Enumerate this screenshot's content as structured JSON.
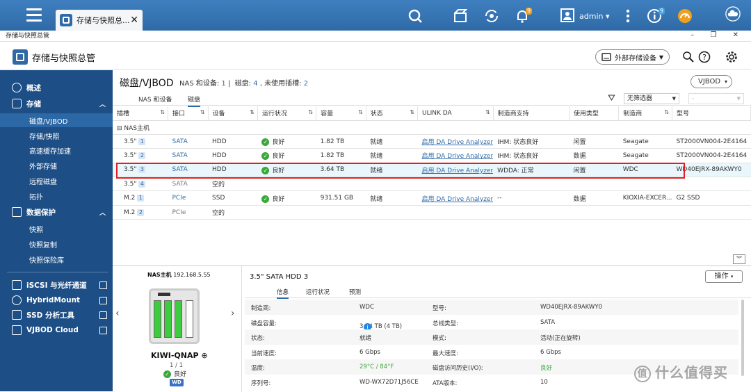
{
  "topbar": {
    "tab_title": "存储与快照总...",
    "tab_close": "✕",
    "notif_badge": "9",
    "info_badge": "9",
    "user": "admin ▾"
  },
  "window_title": "存储与快照总管",
  "window_controls": "– ❐ ✕",
  "app": {
    "title": "存储与快照总管",
    "external_button": "外部存储设备"
  },
  "sidebar": {
    "items": [
      {
        "label": "概述",
        "icon": "dashboard-icon"
      },
      {
        "label": "存储",
        "icon": "storage-icon"
      },
      {
        "label": "磁盘/VJBOD"
      },
      {
        "label": "存储/快照"
      },
      {
        "label": "高速缓存加速"
      },
      {
        "label": "外部存储"
      },
      {
        "label": "远程磁盘"
      },
      {
        "label": "拓扑"
      },
      {
        "label": "数据保护",
        "icon": "shield-icon"
      },
      {
        "label": "快照"
      },
      {
        "label": "快照复制"
      },
      {
        "label": "快照保险库"
      },
      {
        "label": "iSCSI 与光纤通道"
      },
      {
        "label": "HybridMount"
      },
      {
        "label": "SSD 分析工具"
      },
      {
        "label": "VJBOD Cloud"
      }
    ]
  },
  "main": {
    "heading": "磁盘/VJBOD",
    "sub_prefix1": "NAS 和设备:",
    "nas_count": "1",
    "sub_prefix2": "磁盘:",
    "disk_count": "4",
    "sub_prefix3": ", 未使用插槽:",
    "unused_slots": "2",
    "vjbod_btn": "VJBOD",
    "tabs": [
      "NAS 和设备",
      "磁盘"
    ],
    "filter_value": "无筛选器",
    "filter2_value": "-",
    "columns": [
      "插槽",
      "接口",
      "设备",
      "运行状况",
      "容量",
      "状态",
      "ULINK DA",
      "制造商支持",
      "使用类型",
      "制造商",
      "型号"
    ],
    "group_label": "NAS主机",
    "rows": [
      {
        "slot": "3.5\"",
        "num": "1",
        "iface": "SATA",
        "dev": "HDD",
        "health": "良好",
        "cap": "1.82 TB",
        "state": "就绪",
        "ulink": "启用 DA Drive Analyzer",
        "support": "IHM:  状态良好",
        "use": "闲置",
        "mfr": "Seagate",
        "model": "ST2000VN004-2E4164"
      },
      {
        "slot": "3.5\"",
        "num": "2",
        "iface": "SATA",
        "dev": "HDD",
        "health": "良好",
        "cap": "1.82 TB",
        "state": "就绪",
        "ulink": "启用 DA Drive Analyzer",
        "support": "IHM:  状态良好",
        "use": "数据",
        "mfr": "Seagate",
        "model": "ST2000VN004-2E4164"
      },
      {
        "slot": "3.5\"",
        "num": "3",
        "iface": "SATA",
        "dev": "HDD",
        "health": "良好",
        "cap": "3.64 TB",
        "state": "就绪",
        "ulink": "启用 DA Drive Analyzer",
        "support": "WDDA:  正常",
        "use": "闲置",
        "mfr": "WDC",
        "model": "WD40EJRX-89AKWY0"
      },
      {
        "slot": "3.5\"",
        "num": "4",
        "iface": "SATA",
        "dev": "空的",
        "health": "",
        "cap": "",
        "state": "",
        "ulink": "",
        "support": "",
        "use": "",
        "mfr": "",
        "model": ""
      },
      {
        "slot": "M.2",
        "num": "1",
        "iface": "PCIe",
        "dev": "SSD",
        "health": "良好",
        "cap": "931.51 GB",
        "state": "就绪",
        "ulink": "启用 DA Drive Analyzer",
        "support": "--",
        "use": "数据",
        "mfr": "KIOXIA-EXCER...",
        "model": "G2 SSD"
      },
      {
        "slot": "M.2",
        "num": "2",
        "iface": "PCIe",
        "dev": "空的",
        "health": "",
        "cap": "",
        "state": "",
        "ulink": "",
        "support": "",
        "use": "",
        "mfr": "",
        "model": ""
      }
    ]
  },
  "device": {
    "nas_label": "NAS主机",
    "ip": "192.168.5.55",
    "name": "KIWI-QNAP",
    "page": "1 / 1",
    "status": "良好",
    "brand": "WD"
  },
  "detail": {
    "title": "3.5\" SATA HDD 3",
    "action": "操作",
    "tabs": [
      "信息",
      "运行状况",
      "预测"
    ],
    "rows": [
      {
        "k1": "制造商:",
        "v1": "WDC",
        "k2": "型号:",
        "v2": "WD40EJRX-89AKWY0"
      },
      {
        "k1": "磁盘容量:",
        "v1": "3.64 TB (4 TB)",
        "k2": "总线类型:",
        "v2": "SATA"
      },
      {
        "k1": "状态:",
        "v1": "就绪",
        "k2": "模式:",
        "v2": "活动(正在旋转)"
      },
      {
        "k1": "当前速度:",
        "v1": "6 Gbps",
        "k2": "最大速度:",
        "v2": "6 Gbps"
      },
      {
        "k1": "温度:",
        "v1": "29°C / 84°F",
        "k2": "磁盘访问历史(I/O):",
        "v2": "良好"
      },
      {
        "k1": "序列号:",
        "v1": "WD-WX72D71J56CE",
        "k2": "ATA版本:",
        "v2": "10"
      }
    ]
  },
  "watermark": "什么值得买",
  "colors": {
    "accent": "#2f6aa7",
    "sidebar": "#1d4f86",
    "good": "#3aa83a",
    "highlight": "#e02020"
  }
}
